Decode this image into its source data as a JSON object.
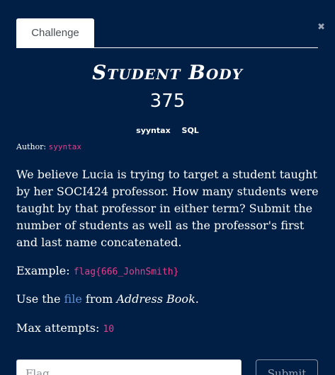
{
  "modal": {
    "close_glyph": "✖"
  },
  "tabs": [
    {
      "label": "Challenge"
    }
  ],
  "challenge": {
    "title": "Student Body",
    "points": "375",
    "tags": [
      "syyntax",
      "SQL"
    ],
    "author_label": "Author:",
    "author_name": "syyntax",
    "description": "We believe Lucia is trying to target a student taught by her SOCI424 professor. How many students were taught by that professor in either term? Submit the number of students as well as the professor's first and last name concatenated.",
    "example_label": "Example:",
    "example_value": "flag{666_JohnSmith}",
    "use_prefix": "Use the",
    "use_link": "file",
    "use_middle": "from",
    "use_source": "Address Book",
    "use_suffix": ".",
    "attempts_label": "Max attempts:",
    "attempts_value": "10"
  },
  "form": {
    "flag_placeholder": "Flag",
    "submit_label": "Submit"
  },
  "colors": {
    "background": "#011f44",
    "accent_pink": "#e83e8c",
    "link_blue": "#5b8fd6"
  }
}
